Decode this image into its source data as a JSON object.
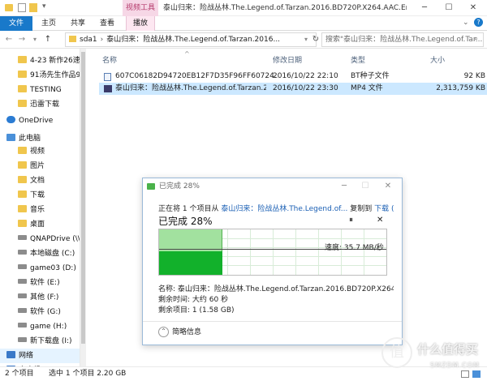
{
  "window": {
    "context_tab": "视频工具",
    "title": "泰山归来：险战丛林.The.Legend.of.Tarzan.2016.BD720P.X264.AAC.Engl..."
  },
  "ribbon": {
    "tabs": [
      "文件",
      "主页",
      "共享",
      "查看",
      "播放"
    ]
  },
  "address": {
    "path_root": "sda1",
    "path_folder": "泰山归来：险战丛林.The.Legend.of.Tarzan.2016...",
    "search_placeholder": "搜索\"泰山归来：险战丛林.The.Legend.of.Tar..."
  },
  "sidebar": {
    "items": [
      {
        "label": "4-23 新作26速8",
        "icon": "folder-icon"
      },
      {
        "label": "91汤先生作品9部",
        "icon": "folder-icon"
      },
      {
        "label": "TESTING",
        "icon": "folder-icon"
      },
      {
        "label": "迅雷下载",
        "icon": "folder-icon"
      },
      {
        "label": "OneDrive",
        "icon": "cloud-icon"
      },
      {
        "label": "此电脑",
        "icon": "computer-icon"
      },
      {
        "label": "视频",
        "icon": "folder-icon"
      },
      {
        "label": "图片",
        "icon": "folder-icon"
      },
      {
        "label": "文档",
        "icon": "folder-icon"
      },
      {
        "label": "下载",
        "icon": "folder-icon"
      },
      {
        "label": "音乐",
        "icon": "folder-icon"
      },
      {
        "label": "桌面",
        "icon": "folder-icon"
      },
      {
        "label": "QNAPDrive (\\\\Q",
        "icon": "drive-icon"
      },
      {
        "label": "本地磁盘 (C:)",
        "icon": "drive-icon"
      },
      {
        "label": "game03 (D:)",
        "icon": "drive-icon"
      },
      {
        "label": "软件 (E:)",
        "icon": "drive-icon"
      },
      {
        "label": "其他 (F:)",
        "icon": "drive-icon"
      },
      {
        "label": "软件 (G:)",
        "icon": "drive-icon"
      },
      {
        "label": "game (H:)",
        "icon": "drive-icon"
      },
      {
        "label": "新下载盘 (I:)",
        "icon": "drive-icon"
      },
      {
        "label": "网络",
        "icon": "network-icon"
      },
      {
        "label": "家庭组",
        "icon": "homegroup-icon"
      }
    ]
  },
  "files": {
    "columns": [
      "名称",
      "修改日期",
      "类型",
      "大小"
    ],
    "rows": [
      {
        "name": "607C06182D94720EB12F7D35F96FF60724...",
        "date": "2016/10/22 22:10",
        "type": "BT种子文件",
        "size": "92 KB",
        "icon": "torrent-file-icon",
        "selected": false
      },
      {
        "name": "泰山归来：险战丛林.The.Legend.of.Tarzan.20...",
        "date": "2016/10/22 23:30",
        "type": "MP4 文件",
        "size": "2,313,759 KB",
        "icon": "video-file-icon",
        "selected": true
      }
    ]
  },
  "status": {
    "count": "2 个项目",
    "selection": "选中 1 个项目  2.20 GB"
  },
  "dialog": {
    "title": "已完成 28%",
    "copy_prefix": "正在将 1 个项目从",
    "copy_source": "泰山归来：险战丛林.The.Legend.of...",
    "copy_mid": "复制到",
    "copy_dest": "下载 (G:)",
    "percent_label": "已完成 28%",
    "progress_fraction": 0.28,
    "speed": "速度: 35.7 MB/秒",
    "name_line": "名称: 泰山归来：险战丛林.The.Legend.of.Tarzan.2016.BD720P.X264...",
    "time_left": "剩余时间: 大约 60 秒",
    "items_left": "剩余项目: 1 (1.58 GB)",
    "details_label": "简略信息",
    "pause_icon": "pause-icon",
    "cancel_icon": "cancel-icon"
  },
  "watermark": {
    "text": "什么值得买",
    "sub": "SMZDM.COM"
  }
}
